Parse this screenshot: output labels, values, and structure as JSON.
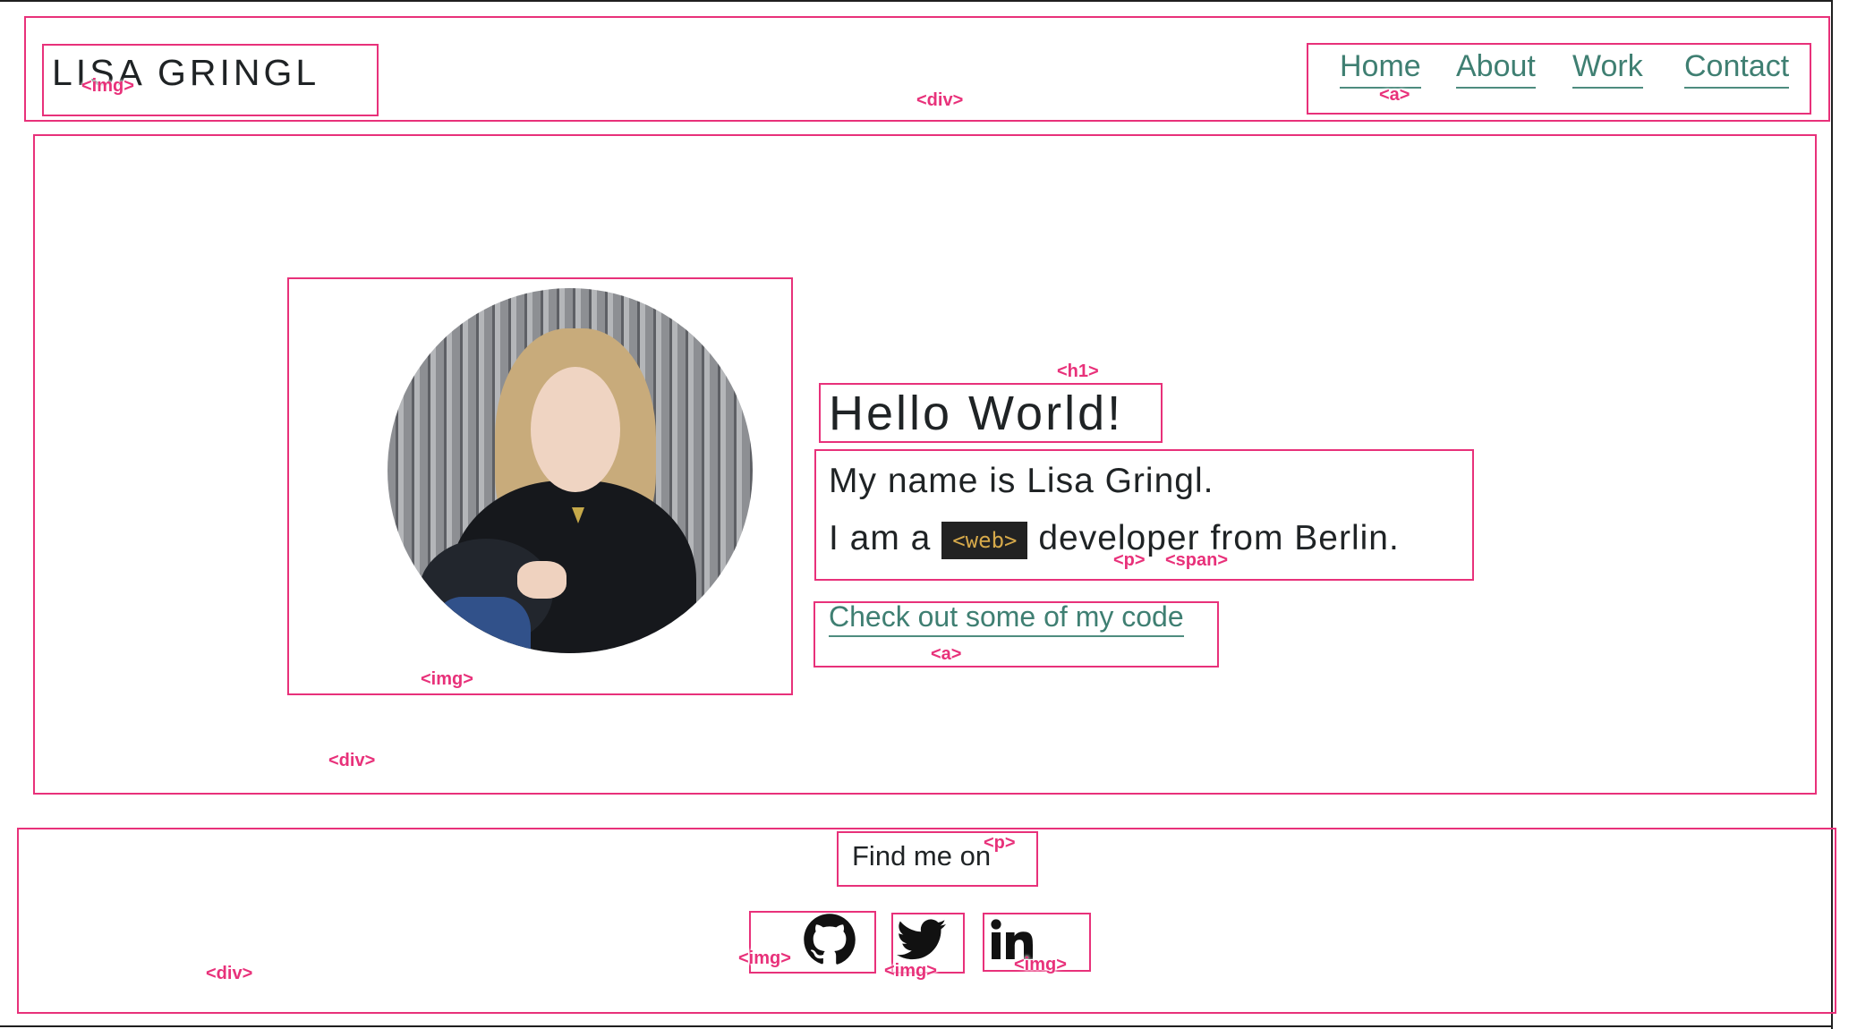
{
  "header": {
    "logo_text": "LISA GRINGL",
    "nav": [
      {
        "label": "Home"
      },
      {
        "label": "About"
      },
      {
        "label": "Work"
      },
      {
        "label": "Contact"
      }
    ]
  },
  "hero": {
    "title": "Hello World!",
    "intro_line1": "My name is Lisa Gringl.",
    "intro_line2_prefix": "I am a",
    "intro_badge": "<web>",
    "intro_line2_suffix": "developer from Berlin.",
    "cta_label": "Check out some of my code"
  },
  "footer": {
    "find_me": "Find me on",
    "social": [
      {
        "icon": "github-icon"
      },
      {
        "icon": "twitter-icon"
      },
      {
        "icon": "linkedin-icon"
      }
    ]
  },
  "annotations": {
    "img": "<img>",
    "a": "<a>",
    "div": "<div>",
    "h1": "<h1>",
    "p": "<p>",
    "span": "<span>"
  },
  "colors": {
    "annotation": "#e8317a",
    "link": "#3f7f72",
    "text": "#1f2325",
    "badge_bg": "#222222",
    "badge_text": "#d6a94a"
  }
}
